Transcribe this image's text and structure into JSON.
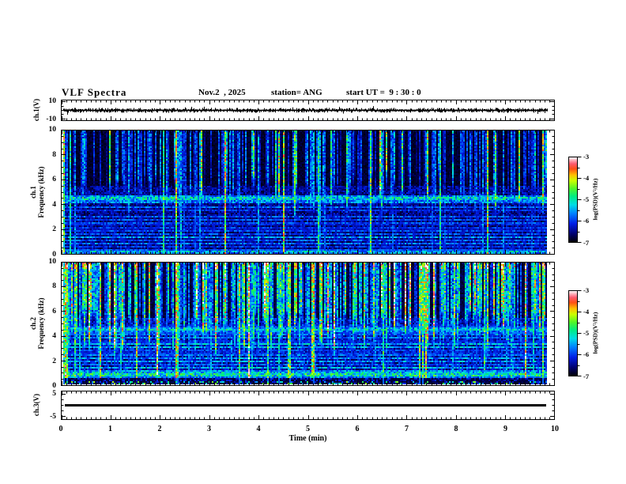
{
  "header": {
    "title": "VLF Spectra",
    "date": "Nov.2  , 2025",
    "station": "station= ANG",
    "start_ut": "start UT =  9 : 30 : 0"
  },
  "chart_data": [
    {
      "type": "line",
      "name": "ch1-voltage-waveform",
      "ylabel": "ch.1(V)",
      "ylim": [
        -12,
        12
      ],
      "yticks": [
        10,
        -10
      ],
      "yminor": [
        5,
        0,
        -5
      ],
      "description": "broadband noise trace oscillating around 0 V, ~±1.5 V envelope, full 10 min",
      "render": {
        "seed": 3,
        "amp": 2.4,
        "spike_prob": 0.012,
        "spike_amp": 3.5
      }
    },
    {
      "type": "heatmap",
      "name": "ch1-spectrogram",
      "ylabel_line1": "ch.1",
      "ylabel_line2": "Frequency (kHz)",
      "ylim": [
        0,
        10
      ],
      "yticks": [
        0,
        2,
        4,
        6,
        8,
        10
      ],
      "yminor_step": 0.5,
      "colorbar": {
        "label": "log(PSD)(V²/Hz)",
        "ticks": [
          -3,
          -4,
          -5,
          -6,
          -7
        ],
        "range": [
          -7,
          -3
        ]
      },
      "description": "vertical sferic streaks above ~5 kHz (blue/cyan, few green-yellow), strong horizontal band near 4.5 kHz and many narrow power-line/tweek bands below 4 kHz",
      "render": {
        "seed": 7,
        "pStrong": 0.012,
        "strong": [
          0.78,
          0.95
        ],
        "pMed": 0.05,
        "med": [
          0.5,
          0.72
        ],
        "pWeak": 0.5,
        "weak": [
          0.12,
          0.45
        ],
        "depth": 5.0,
        "fullLines": 7,
        "hotLine": true,
        "baseLow": 0.13,
        "baseHigh": 0.045,
        "redTop": false,
        "bottomDark": false,
        "bands": [
          {
            "f": 4.5,
            "w": 0.3,
            "a": 0.55
          },
          {
            "f": 4.15,
            "w": 0.1,
            "a": 0.4
          },
          {
            "f": 3.8,
            "w": 0.09,
            "a": 0.35
          },
          {
            "f": 3.5,
            "w": 0.09,
            "a": 0.3
          },
          {
            "f": 3.05,
            "w": 0.09,
            "a": 0.38
          },
          {
            "f": 2.75,
            "w": 0.09,
            "a": 0.3
          },
          {
            "f": 2.45,
            "w": 0.09,
            "a": 0.4
          },
          {
            "f": 2.15,
            "w": 0.09,
            "a": 0.32
          },
          {
            "f": 1.9,
            "w": 0.09,
            "a": 0.36
          },
          {
            "f": 1.6,
            "w": 0.09,
            "a": 0.3
          },
          {
            "f": 1.35,
            "w": 0.09,
            "a": 0.38
          },
          {
            "f": 1.1,
            "w": 0.09,
            "a": 0.32
          },
          {
            "f": 0.85,
            "w": 0.09,
            "a": 0.36
          },
          {
            "f": 0.6,
            "w": 0.09,
            "a": 0.3
          },
          {
            "f": 0.35,
            "w": 0.09,
            "a": 0.34
          },
          {
            "f": 0.15,
            "w": 0.18,
            "a": 0.5
          }
        ]
      }
    },
    {
      "type": "heatmap",
      "name": "ch2-spectrogram",
      "ylabel_line1": "ch.2",
      "ylabel_line2": "Frequency (kHz)",
      "ylim": [
        0,
        10
      ],
      "yticks": [
        0,
        2,
        4,
        6,
        8,
        10
      ],
      "yminor_step": 0.5,
      "colorbar": {
        "label": "log(PSD)(V²/Hz)",
        "ticks": [
          -3,
          -4,
          -5,
          -6,
          -7
        ],
        "range": [
          -7,
          -3
        ]
      },
      "description": "much brighter sferic streaks (green/yellow/red) above ~4.5 kHz, dense horizontal bands below 4 kHz incl. strong orange band near 0.8 kHz, dark noise floor under 0.5 kHz",
      "render": {
        "seed": 13,
        "pStrong": 0.05,
        "strong": [
          0.82,
          1.0
        ],
        "pMed": 0.2,
        "med": [
          0.55,
          0.85
        ],
        "pWeak": 0.45,
        "weak": [
          0.25,
          0.55
        ],
        "depth": 4.5,
        "fullLines": 13,
        "hotLine": false,
        "baseLow": 0.17,
        "baseHigh": 0.06,
        "redTop": true,
        "bottomDark": true,
        "bands": [
          {
            "f": 4.5,
            "w": 0.25,
            "a": 0.5
          },
          {
            "f": 4.15,
            "w": 0.1,
            "a": 0.45
          },
          {
            "f": 3.8,
            "w": 0.09,
            "a": 0.4
          },
          {
            "f": 3.5,
            "w": 0.09,
            "a": 0.35
          },
          {
            "f": 3.3,
            "w": 0.09,
            "a": 0.45
          },
          {
            "f": 3.05,
            "w": 0.09,
            "a": 0.4
          },
          {
            "f": 2.75,
            "w": 0.09,
            "a": 0.35
          },
          {
            "f": 2.45,
            "w": 0.09,
            "a": 0.45
          },
          {
            "f": 2.15,
            "w": 0.09,
            "a": 0.38
          },
          {
            "f": 1.9,
            "w": 0.09,
            "a": 0.42
          },
          {
            "f": 1.6,
            "w": 0.09,
            "a": 0.35
          },
          {
            "f": 1.35,
            "w": 0.09,
            "a": 0.45
          },
          {
            "f": 1.1,
            "w": 0.09,
            "a": 0.38
          },
          {
            "f": 1.0,
            "w": 0.08,
            "a": 0.55
          },
          {
            "f": 0.78,
            "w": 0.1,
            "a": 0.8
          },
          {
            "f": 0.6,
            "w": 0.08,
            "a": 0.4
          }
        ]
      }
    },
    {
      "type": "line",
      "name": "ch3-voltage-waveform",
      "ylabel": "ch.3(V)",
      "ylim": [
        -6.5,
        6.5
      ],
      "yticks": [
        5,
        -5
      ],
      "yminor": [
        2.5,
        0,
        -2.5
      ],
      "description": "flat thick line at 0 V for full 10 min",
      "render": {
        "flat_value": 0,
        "thickness": 3
      }
    }
  ],
  "x_axis": {
    "label": "Time (min)",
    "lim": [
      0,
      10
    ],
    "ticks": [
      "0",
      "1",
      "2",
      "3",
      "4",
      "5",
      "6",
      "7",
      "8",
      "9",
      "10"
    ],
    "minor_step": 0.1
  }
}
